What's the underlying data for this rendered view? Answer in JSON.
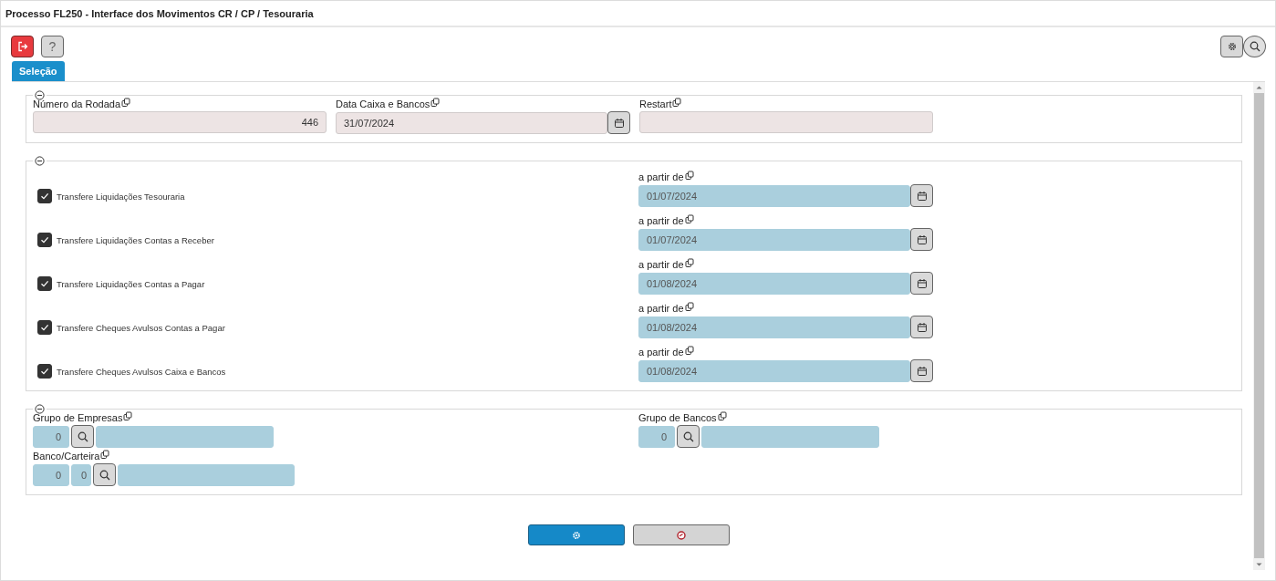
{
  "window": {
    "title": "Processo FL250 - Interface dos Movimentos CR / CP / Tesouraria"
  },
  "toolbar": {
    "help_label": "?"
  },
  "tabs": [
    {
      "label": "Seleção",
      "selected": true
    }
  ],
  "sections": [
    {
      "kind": "fields",
      "expanded": true,
      "fields": [
        {
          "kind": "number",
          "label": "Número da Rodada",
          "value": "446"
        },
        {
          "kind": "date",
          "label": "Data Caixa e Bancos",
          "value": "31/07/2024"
        },
        {
          "kind": "text",
          "label": "Restart"
        }
      ]
    },
    {
      "kind": "transfers",
      "expanded": true,
      "rows": [
        {
          "label": "Transfere Liquidações Tesouraria",
          "checked": true,
          "date_label": "a partir de",
          "date": "01/07/2024"
        },
        {
          "label": "Transfere Liquidações Contas a Receber",
          "checked": true,
          "date_label": "a partir de",
          "date": "01/07/2024"
        },
        {
          "label": "Transfere Liquidações Contas a Pagar",
          "checked": true,
          "date_label": "a partir de",
          "date": "01/08/2024"
        },
        {
          "label": "Transfere Cheques Avulsos Contas a Pagar",
          "checked": true,
          "date_label": "a partir de",
          "date": "01/08/2024"
        },
        {
          "label": "Transfere Cheques Avulsos Caixa e Bancos",
          "checked": true,
          "date_label": "a partir de",
          "date": "01/08/2024"
        }
      ]
    },
    {
      "kind": "lookups",
      "expanded": true,
      "lookups": [
        {
          "label": "Grupo de Empresas",
          "codes": [
            "0"
          ]
        },
        {
          "label": "Grupo de Bancos",
          "codes": [
            "0"
          ]
        },
        {
          "label": "Banco/Carteira",
          "codes": [
            "0",
            "0"
          ]
        }
      ]
    }
  ]
}
